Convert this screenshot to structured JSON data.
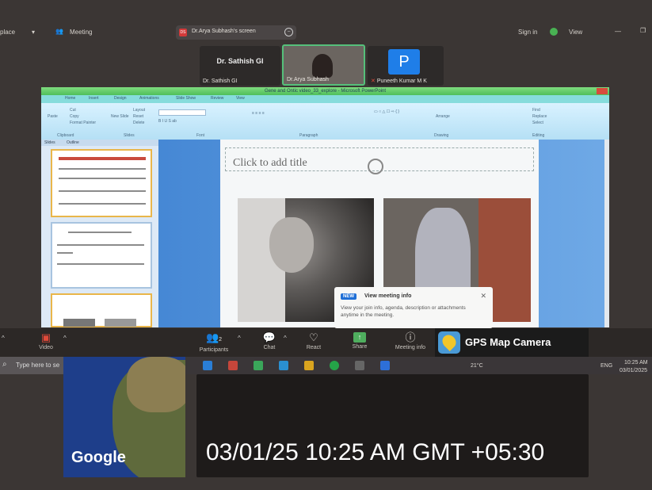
{
  "topbar": {
    "left_label": "place",
    "meeting_label": "Meeting",
    "share_indicator": "Dr.Arya Subhash's screen",
    "share_badge": "DS",
    "signin_label": "Sign in",
    "view_label": "View"
  },
  "participants": [
    {
      "name": "Dr. Sathish GI",
      "display": "Dr. Sathish GI"
    },
    {
      "name": "Dr.Arya Subhash"
    },
    {
      "name": "Puneeth Kumar M K",
      "initial": "P"
    }
  ],
  "ppt": {
    "title": "Gene and Ontic video_33_explore - Microsoft PowerPoint",
    "tabs": [
      "Home",
      "Insert",
      "Design",
      "Animations",
      "Slide Show",
      "Review",
      "View"
    ],
    "ribbon": {
      "paste": "Paste",
      "cut": "Cut",
      "copy": "Copy",
      "format_painter": "Format Painter",
      "new_slide": "New Slide",
      "layout": "Layout",
      "reset": "Reset",
      "delete": "Delete",
      "find": "Find",
      "replace": "Replace",
      "select": "Select",
      "arrange": "Arrange",
      "groups": [
        "Clipboard",
        "Slides",
        "Font",
        "Paragraph",
        "Drawing",
        "Editing"
      ]
    },
    "pane_tabs": [
      "Slides",
      "Outline"
    ],
    "slide_title_placeholder": "Click to add title"
  },
  "popup": {
    "badge": "NEW",
    "title": "View meeting info",
    "description": "View your join info, agenda, description or attachments anytime in the meeting."
  },
  "toolbar": {
    "items": [
      {
        "label": "Video",
        "icon": "video-icon"
      },
      {
        "label": "Participants",
        "count": "2"
      },
      {
        "label": "Chat"
      },
      {
        "label": "React"
      },
      {
        "label": "Share"
      },
      {
        "label": "Meeting info"
      }
    ]
  },
  "gps": {
    "label": "GPS Map Camera"
  },
  "taskbar": {
    "search_placeholder": "Type here to se",
    "temperature": "21°C",
    "language": "ENG",
    "time": "10:25 AM",
    "date": "03/01/2025"
  },
  "map": {
    "brand": "Google"
  },
  "stamp": {
    "text": "03/01/25 10:25 AM GMT +05:30"
  }
}
